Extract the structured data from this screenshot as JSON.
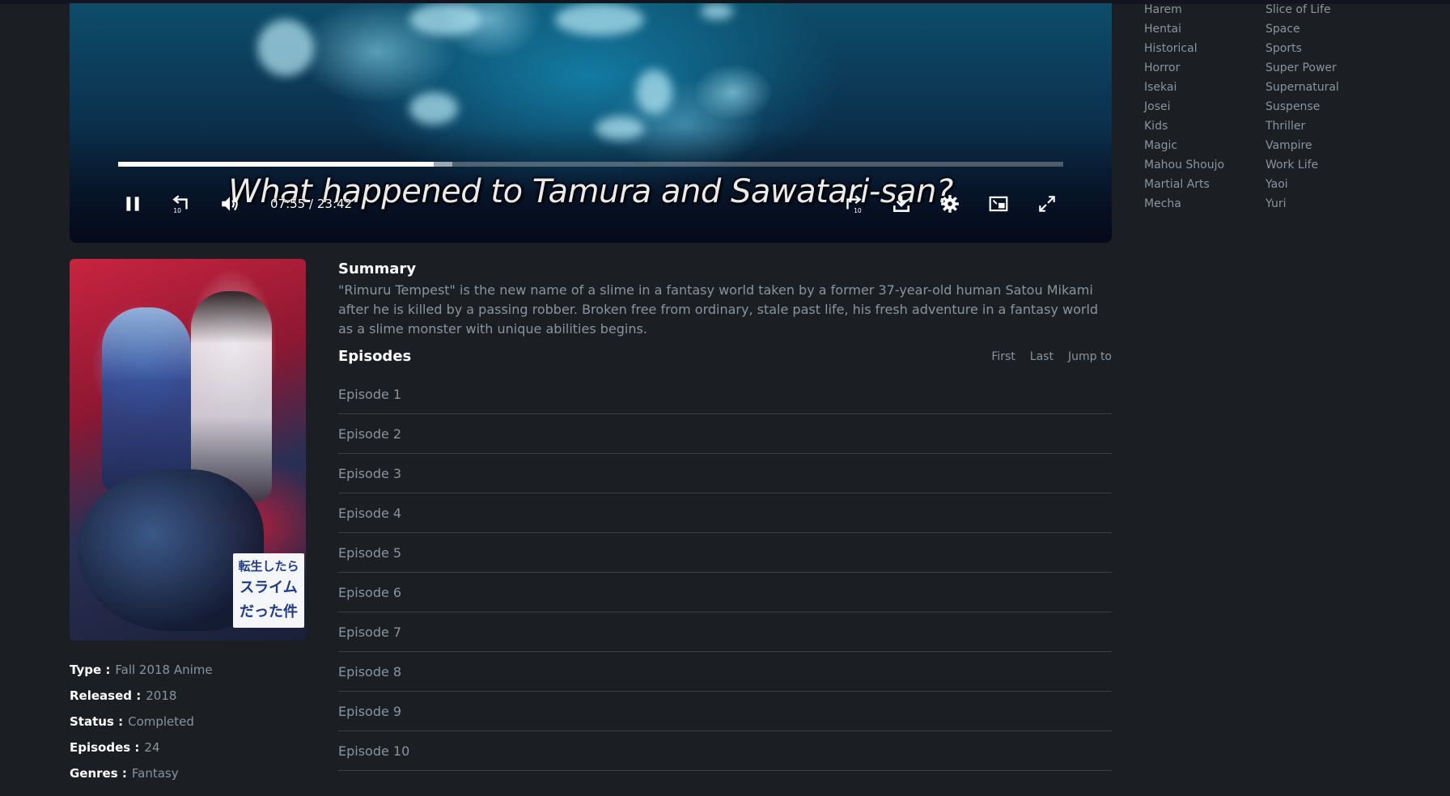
{
  "player": {
    "subtitle": "What happened to Tamura and Sawatari-san?",
    "current_time": "07:55",
    "time_separator": "/",
    "duration": "23:42",
    "progress_fraction": 0.334,
    "buffered_fraction": 0.354,
    "controls": {
      "play_pause": "pause-icon",
      "rewind": "rewind-10-icon",
      "rewind_label": "10",
      "volume": "volume-icon",
      "forward": "forward-10-icon",
      "forward_label": "10",
      "download": "download-icon",
      "settings": "gear-icon",
      "pip": "picture-in-picture-icon",
      "fullscreen": "fullscreen-icon"
    }
  },
  "genres": {
    "left": [
      "Harem",
      "Hentai",
      "Historical",
      "Horror",
      "Isekai",
      "Josei",
      "Kids",
      "Magic",
      "Mahou Shoujo",
      "Martial Arts",
      "Mecha"
    ],
    "right": [
      "Slice of Life",
      "Space",
      "Sports",
      "Super Power",
      "Supernatural",
      "Suspense",
      "Thriller",
      "Vampire",
      "Work Life",
      "Yaoi",
      "Yuri"
    ]
  },
  "poster": {
    "logo_lines": [
      "転生したら",
      "スライム",
      "だった件"
    ]
  },
  "info": [
    {
      "label": "Type :",
      "value": "Fall 2018 Anime"
    },
    {
      "label": "Released :",
      "value": "2018"
    },
    {
      "label": "Status :",
      "value": "Completed"
    },
    {
      "label": "Episodes :",
      "value": "24"
    },
    {
      "label": "Genres :",
      "value": "Fantasy"
    }
  ],
  "summary": {
    "title": "Summary",
    "text": "\"Rimuru Tempest\" is the new name of a slime in a fantasy world taken by a former 37-year-old human Satou Mikami after he is killed by a passing robber. Broken free from ordinary, stale past life, his fresh adventure in a fantasy world as a slime monster with unique abilities begins."
  },
  "episodes": {
    "title": "Episodes",
    "nav": {
      "first": "First",
      "last": "Last",
      "jump": "Jump to"
    },
    "items": [
      "Episode 1",
      "Episode 2",
      "Episode 3",
      "Episode 4",
      "Episode 5",
      "Episode 6",
      "Episode 7",
      "Episode 8",
      "Episode 9",
      "Episode 10"
    ]
  }
}
